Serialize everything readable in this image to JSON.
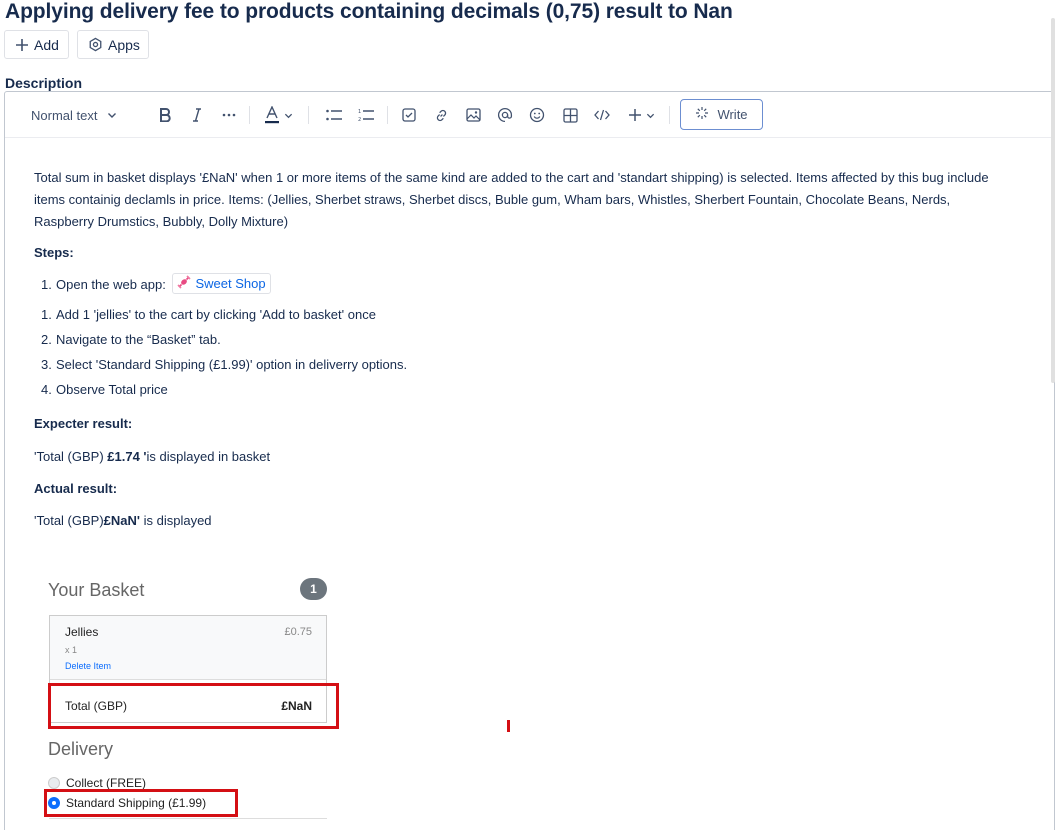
{
  "page": {
    "title": "Applying delivery fee to products containing decimals (0,75) result to Nan"
  },
  "actions": {
    "add_label": "Add",
    "apps_label": "Apps"
  },
  "description": {
    "label": "Description"
  },
  "toolbar": {
    "text_style": "Normal text",
    "write_label": "Write",
    "icons": [
      "bold-icon",
      "italic-icon",
      "more-formatting-icon",
      "text-color-icon",
      "bullet-list-icon",
      "numbered-list-icon",
      "action-item-icon",
      "link-icon",
      "image-icon",
      "mention-icon",
      "emoji-icon",
      "table-icon",
      "code-icon",
      "insert-more-icon",
      "write-ai-icon"
    ]
  },
  "body": {
    "intro": "Total sum in basket displays '£NaN' when 1 or more items of the same kind are added to the cart and 'standart shipping) is selected. Items affected by this bug include items containig declamls in price. Items:  (Jellies, Sherbet straws, Sherbet discs, Buble gum, Wham bars, Whistles, Sherbert Fountain, Chocolate Beans, Nerds, Raspberry Drumstics, Bubbly, Dolly Mixture)",
    "steps_heading": "Steps:",
    "step_open_prefix": "Open the web app:",
    "step_open_number": "1.",
    "sweet_shop_link": "Sweet Shop",
    "steps": [
      {
        "n": "1.",
        "text": "Add 1 'jellies' to the cart by clicking 'Add to basket' once"
      },
      {
        "n": "2.",
        "text": "Navigate to the “Basket” tab."
      },
      {
        "n": "3.",
        "text": "Select 'Standard Shipping (£1.99)' option in deliverry options."
      },
      {
        "n": "4.",
        "text": "Observe Total price"
      }
    ],
    "expected_heading": "Expecter result:",
    "expected_prefix": "'Total (GBP) ",
    "expected_bold": "£1.74 '",
    "expected_suffix": "is displayed in basket",
    "actual_heading": "Actual result:",
    "actual_prefix": "'Total (GBP)",
    "actual_bold": "£NaN'",
    "actual_suffix": " is displayed"
  },
  "screenshot": {
    "basket_title": "Your Basket",
    "basket_count": "1",
    "item_name": "Jellies",
    "item_qty": "x 1",
    "item_delete": "Delete Item",
    "item_price": "£0.75",
    "total_label": "Total (GBP)",
    "total_value": "£NaN",
    "delivery_title": "Delivery",
    "option_collect": "Collect (FREE)",
    "option_standard": "Standard Shipping (£1.99)",
    "highlight_color": "#d40f14"
  }
}
